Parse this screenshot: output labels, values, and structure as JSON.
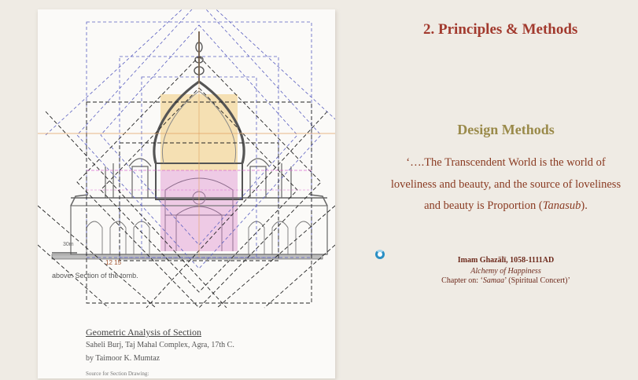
{
  "slide": {
    "title": "2. Principles & Methods",
    "section_heading": "Design Methods",
    "quote_parts": [
      "‘….The Transcendent World is the world of loveliness and beauty, and the source of loveliness and beauty is Proportion (",
      "Tanasub",
      ")."
    ],
    "attribution": {
      "name": "Imam Ghazālī, 1058-1111AD",
      "book": "Alchemy of Happiness",
      "chapter_prefix": "Chapter on: ‘",
      "chapter_italic": "Samaa",
      "chapter_suffix": "’ (Spiritual Concert)’"
    }
  },
  "drawing": {
    "scale_label": "30m",
    "dim_label": "12  15",
    "caption": "above: Section of the tomb.",
    "caption_title": "Geometric Analysis of Section",
    "caption_line1": "Saheli Burj, Taj Mahal Complex, Agra, 17th C.",
    "caption_line2": "by Taimoor K. Mumtaz",
    "caption_line3": "Source for Section Drawing:"
  },
  "colors": {
    "title": "#a23a2e",
    "heading": "#9a8a4a",
    "quote": "#8a3b22",
    "attribution": "#6d2a1c",
    "loading_spinner": "#2a8fc4"
  },
  "icons": {
    "loading": "loading-spinner-icon"
  }
}
